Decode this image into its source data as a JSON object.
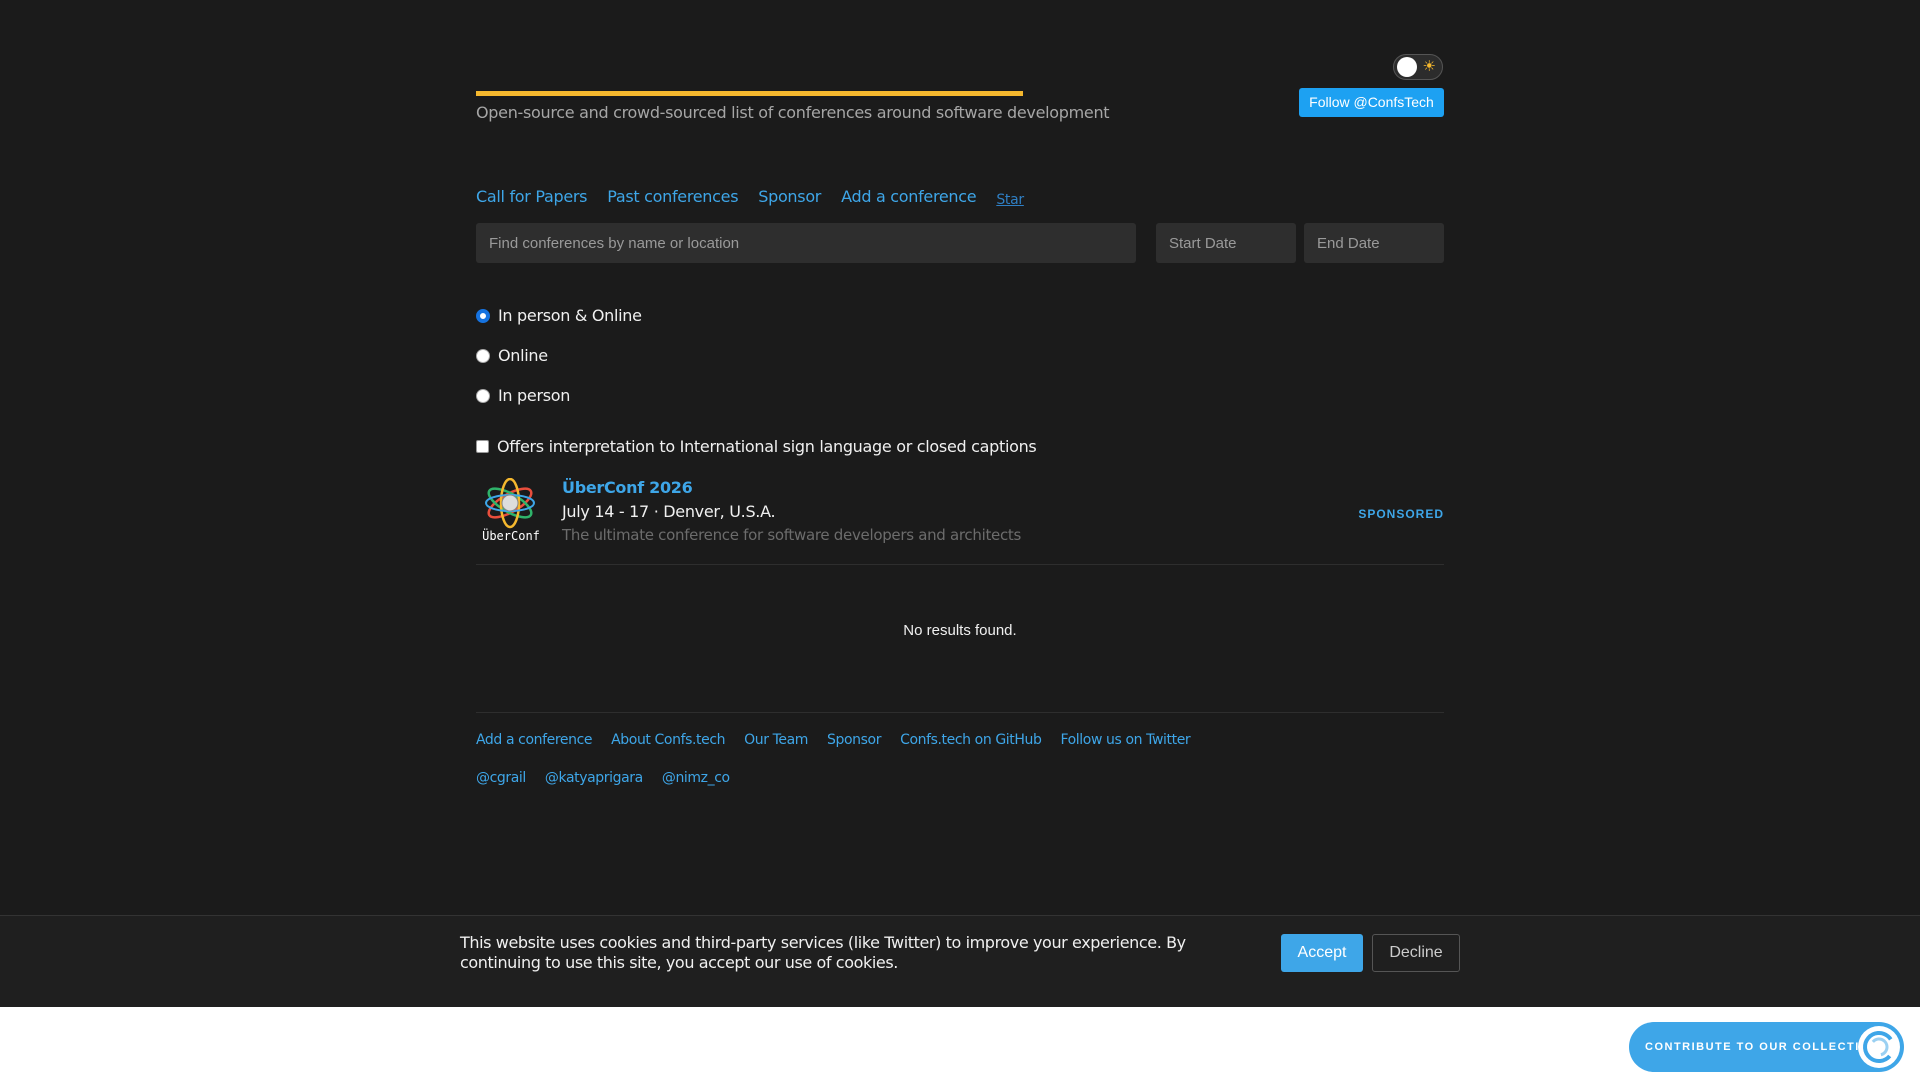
{
  "header": {
    "subtitle": "Open-source and crowd-sourced list of conferences around software development",
    "follow_label": "Follow @ConfsTech",
    "accent_color": "#f5b82e"
  },
  "nav": {
    "items": [
      "Call for Papers",
      "Past conferences",
      "Sponsor",
      "Add a conference"
    ],
    "star_label": "Star"
  },
  "search": {
    "placeholder": "Find conferences by name or location",
    "start_placeholder": "Start Date",
    "end_placeholder": "End Date"
  },
  "filters": {
    "radios": [
      {
        "label": "In person & Online",
        "checked": true
      },
      {
        "label": "Online",
        "checked": false
      },
      {
        "label": "In person",
        "checked": false
      }
    ],
    "accessibility_label": "Offers interpretation to International sign language or closed captions"
  },
  "sponsored": {
    "title": "ÜberConf 2026",
    "meta": "July 14 - 17 · Denver, U.S.A.",
    "description": "The ultimate conference for software developers and architects",
    "tag": "SPONSORED",
    "logo_text": "ÜberConf"
  },
  "results": {
    "empty_message": "No results found."
  },
  "footer": {
    "links": [
      "Add a conference",
      "About Confs.tech",
      "Our Team",
      "Sponsor",
      "Confs.tech on GitHub",
      "Follow us on Twitter"
    ],
    "handles": [
      "@cgrail",
      "@katyaprigara",
      "@nimz_co"
    ]
  },
  "cookie": {
    "text": "This website uses cookies and third-party services (like Twitter) to improve your experience. By continuing to use this site, you accept our use of cookies.",
    "accept_label": "Accept",
    "decline_label": "Decline"
  },
  "collective": {
    "label": "CONTRIBUTE TO OUR COLLECTIVE"
  }
}
